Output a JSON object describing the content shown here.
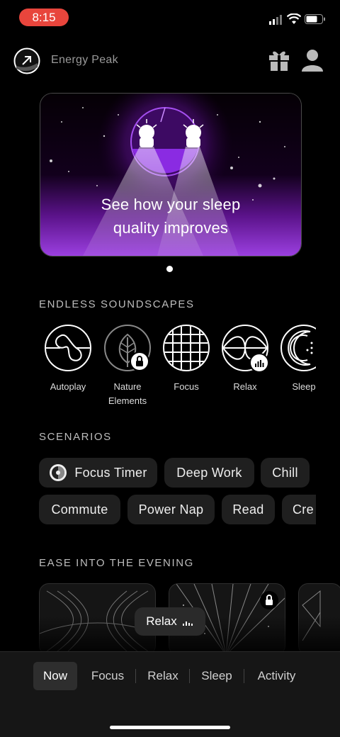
{
  "status": {
    "time": "8:15"
  },
  "header": {
    "app_name": "Energy Peak",
    "gift_icon": "gift-icon",
    "profile_icon": "user-icon",
    "logo_icon": "arrow-up-right-icon"
  },
  "hero": {
    "line1": "See how your sleep",
    "line2": "quality improves",
    "page_count": 1,
    "active_page": 1
  },
  "soundscapes": {
    "title": "ENDLESS SOUNDSCAPES",
    "items": [
      {
        "label1": "Autoplay",
        "label2": ""
      },
      {
        "label1": "Nature",
        "label2": "Elements",
        "locked": true
      },
      {
        "label1": "Focus",
        "label2": ""
      },
      {
        "label1": "Relax",
        "label2": ""
      },
      {
        "label1": "Sleep",
        "label2": ""
      }
    ]
  },
  "scenarios": {
    "title": "SCENARIOS",
    "row1": [
      "Focus Timer",
      "Deep Work",
      "Chill"
    ],
    "row2": [
      "Commute",
      "Power Nap",
      "Read",
      "Cre"
    ]
  },
  "evening": {
    "title": "EASE INTO THE EVENING"
  },
  "now_playing": {
    "label": "Relax"
  },
  "tabs": [
    "Now",
    "Focus",
    "Relax",
    "Sleep",
    "Activity"
  ],
  "colors": {
    "accent": "#8a2be2",
    "status_pill": "#e8453c",
    "background": "#000000"
  }
}
